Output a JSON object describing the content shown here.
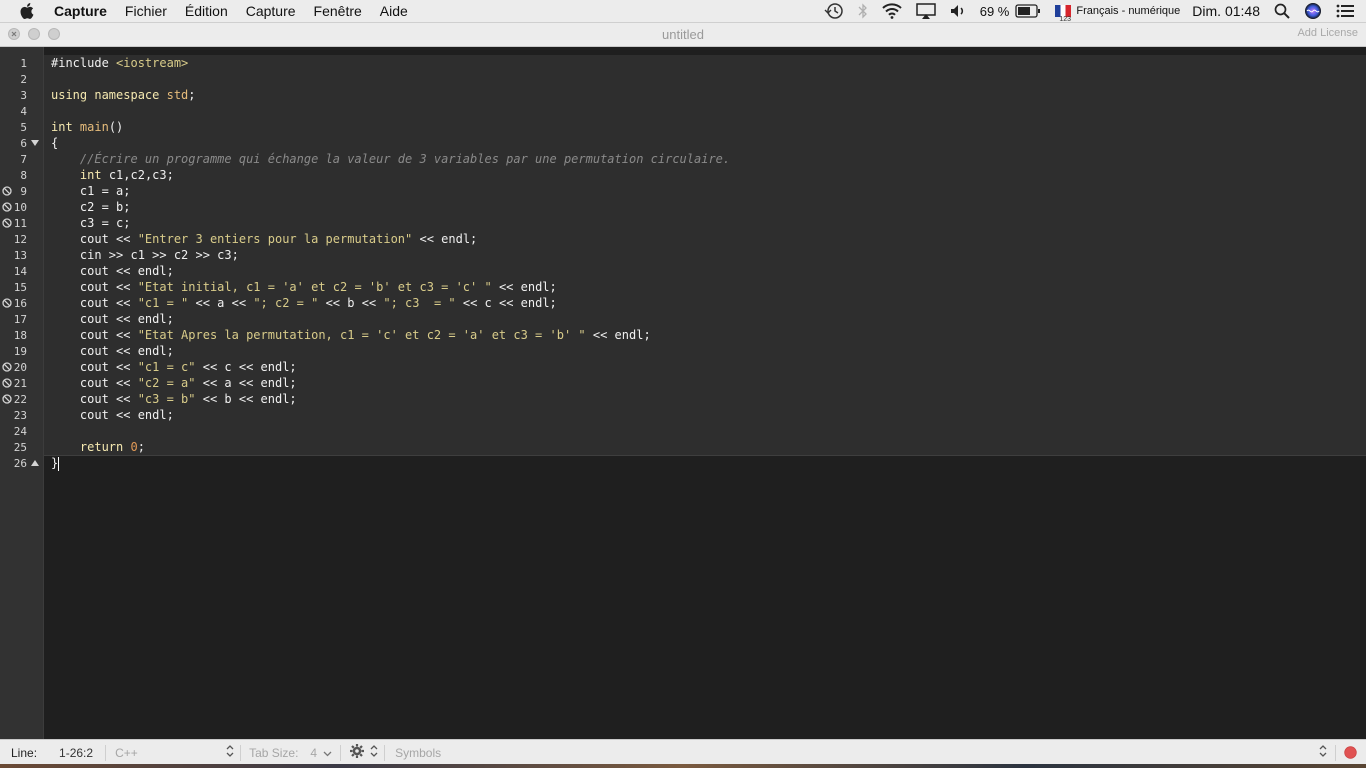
{
  "menubar": {
    "app_name": "Capture",
    "items": [
      "Fichier",
      "Édition",
      "Capture",
      "Fenêtre",
      "Aide"
    ],
    "battery": "69 %",
    "input_source": "Français - numérique",
    "input_source_sub": "123",
    "clock": "Dim. 01:48"
  },
  "window": {
    "title": "untitled",
    "add_license": "Add License"
  },
  "editor": {
    "line_numbers": [
      "1",
      "2",
      "3",
      "4",
      "5",
      "6",
      "7",
      "8",
      "9",
      "10",
      "11",
      "12",
      "13",
      "14",
      "15",
      "16",
      "17",
      "18",
      "19",
      "20",
      "21",
      "22",
      "23",
      "24",
      "25",
      "26"
    ],
    "breakpoint_lines": [
      "9",
      "10",
      "11",
      "16",
      "20",
      "21",
      "22"
    ],
    "fold_lines": [
      "6",
      "26"
    ],
    "lines": {
      "l1": {
        "a": "#include ",
        "b": "<iostream>"
      },
      "l3": {
        "a": "using ",
        "b": "namespace ",
        "c": "std",
        "d": ";"
      },
      "l5": {
        "a": "int ",
        "b": "main",
        "c": "()"
      },
      "l6": {
        "a": "{"
      },
      "l7": {
        "a": "    //Écrire un programme qui échange la valeur de 3 variables par une permutation circulaire."
      },
      "l8": {
        "a": "    ",
        "b": "int",
        "c": " c1,c2,c3;"
      },
      "l9": {
        "a": "    c1 = a;"
      },
      "l10": {
        "a": "    c2 = b;"
      },
      "l11": {
        "a": "    c3 = c;"
      },
      "l12": {
        "a": "    cout << ",
        "b": "\"Entrer 3 entiers pour la permutation\"",
        "c": " << endl;"
      },
      "l13": {
        "a": "    cin >> c1 >> c2 >> c3;"
      },
      "l14": {
        "a": "    cout << endl;"
      },
      "l15": {
        "a": "    cout << ",
        "b": "\"Etat initial, c1 = 'a' et c2 = 'b' et c3 = 'c' \"",
        "c": " << endl;"
      },
      "l16": {
        "a": "    cout << ",
        "b": "\"c1 = \"",
        "c": " << a << ",
        "d": "\"; c2 = \"",
        "e": " << b << ",
        "f": "\"; c3  = \"",
        "g": " << c << endl;"
      },
      "l17": {
        "a": "    cout << endl;"
      },
      "l18": {
        "a": "    cout << ",
        "b": "\"Etat Apres la permutation, c1 = 'c' et c2 = 'a' et c3 = 'b' \"",
        "c": " << endl;"
      },
      "l19": {
        "a": "    cout << endl;"
      },
      "l20": {
        "a": "    cout << ",
        "b": "\"c1 = c\"",
        "c": " << c << endl;"
      },
      "l21": {
        "a": "    cout << ",
        "b": "\"c2 = a\"",
        "c": " << a << endl;"
      },
      "l22": {
        "a": "    cout << ",
        "b": "\"c3 = b\"",
        "c": " << b << endl;"
      },
      "l23": {
        "a": "    cout << endl;"
      },
      "l25": {
        "a": "    ",
        "b": "return ",
        "c": "0",
        "d": ";"
      },
      "l26": {
        "a": "}"
      }
    }
  },
  "statusbar": {
    "line_label": "Line:",
    "line_value": "1-26:2",
    "language": "C++",
    "tab_size_label": "Tab Size:",
    "tab_size_value": "4",
    "symbols": "Symbols"
  },
  "colors": {
    "editor_bg": "#1f1f1f",
    "gutter_bg": "#323232",
    "string": "#d9cc8a",
    "keyword": "#f5e9b0",
    "comment": "#8a8a8a",
    "record_dot": "#e05252"
  },
  "icons": [
    "apple-icon",
    "time-machine-icon",
    "bluetooth-icon",
    "wifi-icon",
    "airplay-icon",
    "volume-icon",
    "battery-icon",
    "flag-icon",
    "spotlight-icon",
    "siri-icon",
    "notification-center-icon",
    "breakpoint-icon",
    "fold-icon",
    "gear-icon",
    "chevron-updown-icon",
    "record-icon"
  ]
}
